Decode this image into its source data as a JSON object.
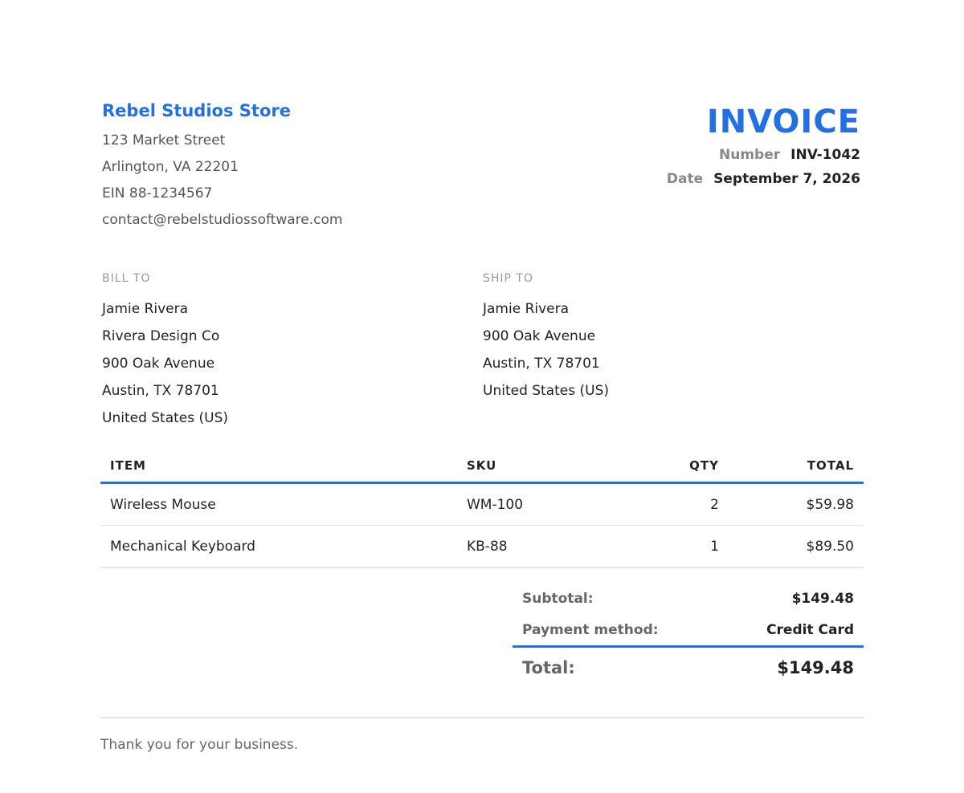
{
  "store": {
    "name": "Rebel Studios Store",
    "lines": [
      "123 Market Street",
      "Arlington, VA 22201",
      "EIN 88-1234567",
      "contact@rebelstudiossoftware.com"
    ]
  },
  "invoice": {
    "title": "INVOICE",
    "number_label": "Number",
    "number": "INV-1042",
    "date_label": "Date",
    "date": "September 7, 2026"
  },
  "bill_to": {
    "heading": "BILL TO",
    "lines": [
      "Jamie Rivera",
      "Rivera Design Co",
      "900 Oak Avenue",
      "Austin, TX 78701",
      "United States (US)"
    ]
  },
  "ship_to": {
    "heading": "SHIP TO",
    "lines": [
      "Jamie Rivera",
      "900 Oak Avenue",
      "Austin, TX 78701",
      "United States (US)"
    ]
  },
  "table": {
    "headers": {
      "item": "ITEM",
      "sku": "SKU",
      "qty": "QTY",
      "total": "TOTAL"
    },
    "rows": [
      {
        "item": "Wireless Mouse",
        "sku": "WM-100",
        "qty": "2",
        "total": "$59.98"
      },
      {
        "item": "Mechanical Keyboard",
        "sku": "KB-88",
        "qty": "1",
        "total": "$89.50"
      }
    ]
  },
  "totals": {
    "subtotal_label": "Subtotal:",
    "subtotal": "$149.48",
    "payment_label": "Payment method:",
    "payment": "Credit Card",
    "total_label": "Total:",
    "total": "$149.48"
  },
  "footer": {
    "note": "Thank you for your business."
  },
  "colors": {
    "accent": "#2270e2",
    "text": "#222222",
    "muted": "#666666"
  }
}
